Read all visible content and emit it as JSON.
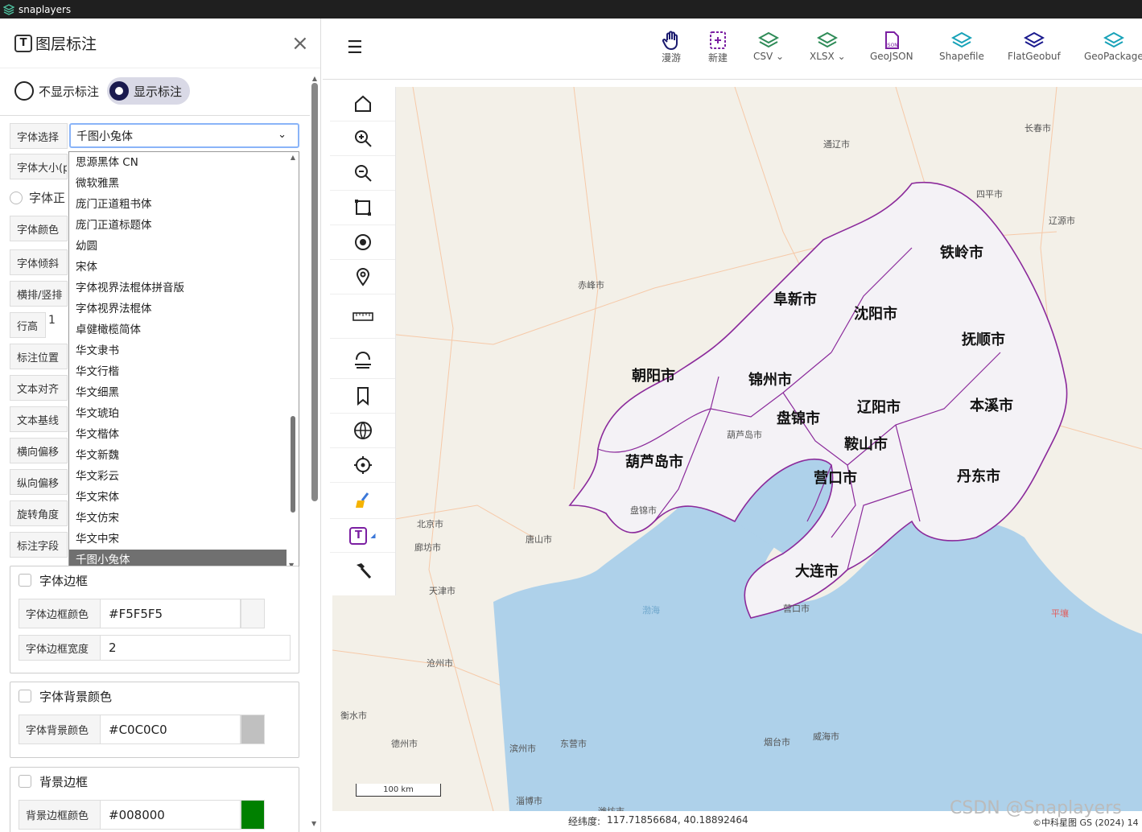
{
  "app": {
    "title": "snaplayers"
  },
  "panel": {
    "title": "图层标注",
    "close": "×",
    "radio_hide": "不显示标注",
    "radio_show": "显示标注",
    "font_select_label": "字体选择",
    "font_select_value": "千图小兔体",
    "font_size_label": "字体大小(p",
    "font_style_label": "字体正",
    "color_label": "字体颜色",
    "italic_label": "字体倾斜",
    "orient_label": "横排/竖排",
    "line_height_label": "行高",
    "line_height_value": "1",
    "position_label": "标注位置",
    "align_label": "文本对齐",
    "baseline_label": "文本基线",
    "offset_x_label": "横向偏移",
    "offset_y_label": "纵向偏移",
    "rotation_label": "旋转角度",
    "field_label": "标注字段",
    "font_options": [
      "思源黑体 CN",
      "微软雅黑",
      "庞门正道粗书体",
      "庞门正道标题体",
      "幼圆",
      "宋体",
      "字体视界法棍体拼音版",
      "字体视界法棍体",
      "卓健橄榄简体",
      "华文隶书",
      "华文行楷",
      "华文细黑",
      "华文琥珀",
      "华文楷体",
      "华文新魏",
      "华文彩云",
      "华文宋体",
      "华文仿宋",
      "华文中宋",
      "千图小兔体"
    ],
    "border_section": "字体边框",
    "border_color_label": "字体边框颜色",
    "border_color_value": "#F5F5F5",
    "border_width_label": "字体边框宽度",
    "border_width_value": "2",
    "bg_section": "字体背景颜色",
    "bg_color_label": "字体背景颜色",
    "bg_color_value": "#C0C0C0",
    "bgborder_section": "背景边框",
    "bgborder_color_label": "背景边框颜色",
    "bgborder_color_value": "#008000"
  },
  "toolbar": {
    "pan": "漫游",
    "new": "新建",
    "csv": "CSV",
    "xlsx": "XLSX",
    "geojson": "GeoJSON",
    "shapefile": "Shapefile",
    "flatgeobuf": "FlatGeobuf",
    "geopackage": "GeoPackage"
  },
  "map": {
    "cities": [
      "铁岭市",
      "阜新市",
      "沈阳市",
      "抚顺市",
      "朝阳市",
      "锦州市",
      "本溪市",
      "盘锦市",
      "辽阳市",
      "葫芦岛市",
      "鞍山市",
      "营口市",
      "丹东市",
      "大连市"
    ],
    "basemap_labels": [
      "长春市",
      "通辽市",
      "四平市",
      "辽源市",
      "赤峰市",
      "北京市",
      "廊坊市",
      "唐山市",
      "天津市",
      "沧州市",
      "衡水市",
      "德州市",
      "滨州市",
      "东营市",
      "烟台市",
      "威海市",
      "淄博市",
      "潍坊市",
      "渤海",
      "平壤",
      "葫芦岛市",
      "盘锦市",
      "营口市"
    ],
    "scale": "100 km",
    "coord_label": "经纬度:",
    "coord_value": "117.71856684, 40.18892464",
    "copyright": "©中科星图 GS (2024) 14",
    "watermark": "CSDN @Snaplayers"
  },
  "colors": {
    "boundary": "#8b2a9b",
    "sea": "#aed1ea",
    "land": "#f3f0e8",
    "province": "#f4f2f6"
  }
}
